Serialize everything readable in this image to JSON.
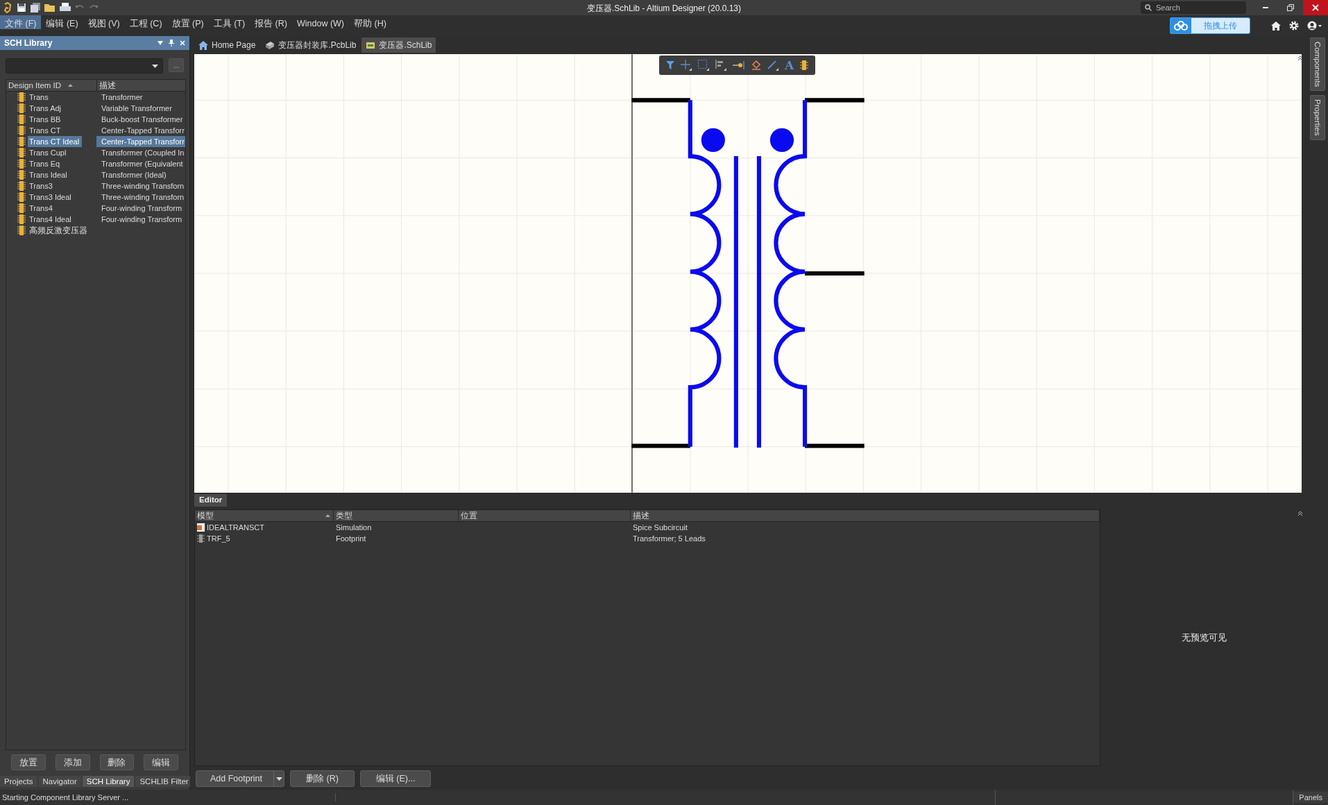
{
  "title_bar": {
    "title": "变压器.SchLib - Altium Designer (20.0.13)",
    "search_placeholder": "Search"
  },
  "menu": [
    {
      "label": "文件 (F)",
      "selected": true
    },
    {
      "label": "编辑 (E)",
      "selected": false
    },
    {
      "label": "视图 (V)",
      "selected": false
    },
    {
      "label": "工程 (C)",
      "selected": false
    },
    {
      "label": "放置 (P)",
      "selected": false
    },
    {
      "label": "工具 (T)",
      "selected": false
    },
    {
      "label": "报告 (R)",
      "selected": false
    },
    {
      "label": "Window (W)",
      "selected": false
    },
    {
      "label": "帮助 (H)",
      "selected": false
    }
  ],
  "upload_button": "拖拽上传",
  "left_panel": {
    "title": "SCH Library",
    "browse_button": "...",
    "columns": [
      "Design Item ID",
      "描述"
    ],
    "items": [
      {
        "id": "Trans",
        "description": "Transformer",
        "selected": false
      },
      {
        "id": "Trans Adj",
        "description": "Variable Transformer",
        "selected": false
      },
      {
        "id": "Trans BB",
        "description": "Buck-boost Transformer",
        "selected": false
      },
      {
        "id": "Trans CT",
        "description": "Center-Tapped Transforr",
        "selected": false
      },
      {
        "id": "Trans CT Ideal",
        "description": "Center-Tapped Transforr",
        "selected": true
      },
      {
        "id": "Trans Cupl",
        "description": "Transformer (Coupled In",
        "selected": false
      },
      {
        "id": "Trans Eq",
        "description": "Transformer (Equivalent",
        "selected": false
      },
      {
        "id": "Trans Ideal",
        "description": "Transformer (Ideal)",
        "selected": false
      },
      {
        "id": "Trans3",
        "description": "Three-winding Transforn",
        "selected": false
      },
      {
        "id": "Trans3 Ideal",
        "description": "Three-winding Transforn",
        "selected": false
      },
      {
        "id": "Trans4",
        "description": "Four-winding Transform",
        "selected": false
      },
      {
        "id": "Trans4 Ideal",
        "description": "Four-winding Transform",
        "selected": false
      },
      {
        "id": "高频反激变压器",
        "selected": false
      }
    ],
    "buttons": [
      "放置",
      "添加",
      "删除",
      "编辑"
    ],
    "tabs": [
      {
        "label": "Projects",
        "selected": false
      },
      {
        "label": "Navigator",
        "selected": false
      },
      {
        "label": "SCH Library",
        "selected": true
      },
      {
        "label": "SCHLIB Filter",
        "selected": false
      }
    ]
  },
  "document_tabs": [
    {
      "label": "Home Page",
      "kind": "home",
      "selected": false
    },
    {
      "label": "变压器封装库.PcbLib",
      "kind": "pcblib",
      "selected": false
    },
    {
      "label": "变压器.SchLib",
      "kind": "schlib",
      "selected": true
    }
  ],
  "canvas_toolbar": {
    "text_tool_glyph": "A"
  },
  "editor": {
    "tab": "Editor",
    "columns": [
      "模型",
      "类型",
      "位置",
      "描述"
    ],
    "rows": [
      {
        "kind": "simulation",
        "cells": [
          "IDEALTRANSCT",
          "Simulation",
          "",
          "Spice Subcircuit"
        ]
      },
      {
        "kind": "footprint",
        "cells": [
          "TRF_5",
          "Footprint",
          "",
          "Transformer; 5 Leads"
        ]
      }
    ],
    "preview_text": "无预览可见",
    "buttons": [
      "Add Footprint",
      "删除 (R)",
      "编辑 (E)..."
    ]
  },
  "side_tabs": [
    "Components",
    "Properties"
  ],
  "status_bar": {
    "text": "Starting Component Library Server ...",
    "panels_button": "Panels"
  }
}
